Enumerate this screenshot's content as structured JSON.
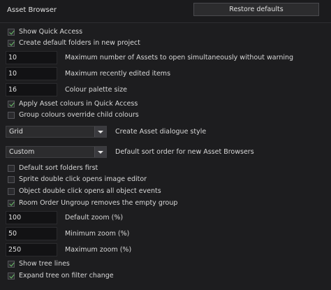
{
  "header": {
    "title": "Asset Browser",
    "restore_label": "Restore defaults"
  },
  "checks": {
    "show_quick_access": {
      "label": "Show Quick Access",
      "checked": true
    },
    "create_default_folders": {
      "label": "Create default folders in new project",
      "checked": true
    },
    "apply_colours": {
      "label": "Apply Asset colours in Quick Access",
      "checked": true
    },
    "group_colours_override": {
      "label": "Group colours override child colours",
      "checked": false
    },
    "default_sort_folders": {
      "label": "Default sort folders first",
      "checked": false
    },
    "sprite_double_click": {
      "label": "Sprite double click opens image editor",
      "checked": false
    },
    "object_double_click": {
      "label": "Object double click opens all object events",
      "checked": false
    },
    "room_order_ungroup": {
      "label": "Room Order Ungroup removes the empty group",
      "checked": true
    },
    "show_tree_lines": {
      "label": "Show tree lines",
      "checked": true
    },
    "expand_tree": {
      "label": "Expand tree on filter change",
      "checked": true
    }
  },
  "fields": {
    "max_assets": {
      "value": "10",
      "label": "Maximum number of Assets to open simultaneously without warning"
    },
    "max_recent": {
      "value": "10",
      "label": "Maximum recently edited items"
    },
    "palette_size": {
      "value": "16",
      "label": "Colour palette size"
    },
    "default_zoom": {
      "value": "100",
      "label": "Default zoom (%)"
    },
    "min_zoom": {
      "value": "50",
      "label": "Minimum zoom (%)"
    },
    "max_zoom": {
      "value": "250",
      "label": "Maximum zoom (%)"
    }
  },
  "dropdowns": {
    "create_style": {
      "value": "Grid",
      "label": "Create Asset dialogue style"
    },
    "sort_order": {
      "value": "Custom",
      "label": "Default sort order for new Asset Browsers"
    }
  },
  "colors": {
    "background": "#1d1d1f",
    "check_mark": "#6cc36b",
    "field_bg": "#121214"
  }
}
